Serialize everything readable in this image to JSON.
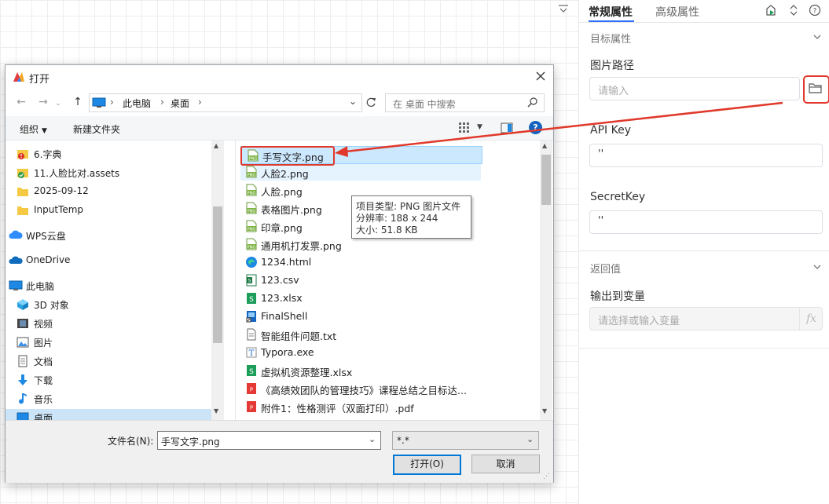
{
  "canvas": {
    "top_right_dropdown": "chevron"
  },
  "panel": {
    "tabs": [
      "常规属性",
      "高级属性"
    ],
    "sections": {
      "target": "目标属性",
      "return": "返回值"
    },
    "fields": {
      "image_path_label": "图片路径",
      "image_path_placeholder": "请输入",
      "api_key_label": "API Key",
      "api_key_value": "''",
      "secret_key_label": "SecretKey",
      "secret_key_value": "''",
      "output_label": "输出到变量",
      "output_placeholder": "请选择或输入变量",
      "fx": "fx"
    }
  },
  "dialog": {
    "title": "打开",
    "breadcrumb": [
      "此电脑",
      "桌面"
    ],
    "search_placeholder": "在 桌面 中搜索",
    "toolbar": {
      "organize": "组织",
      "new_folder": "新建文件夹",
      "help": "?"
    },
    "nav_items": [
      {
        "label": "6.字典",
        "icon": "red-badge-folder-icon"
      },
      {
        "label": "11.人脸比对.assets",
        "icon": "green-check-folder-icon"
      },
      {
        "label": "2025-09-12",
        "icon": "folder-icon"
      },
      {
        "label": "InputTemp",
        "icon": "folder-icon"
      },
      {
        "label": "WPS云盘",
        "icon": "wps-cloud-icon"
      },
      {
        "label": "OneDrive",
        "icon": "onedrive-icon"
      },
      {
        "label": "此电脑",
        "icon": "computer-icon"
      },
      {
        "label": "3D 对象",
        "icon": "3d-objects-icon"
      },
      {
        "label": "视频",
        "icon": "video-icon"
      },
      {
        "label": "图片",
        "icon": "pictures-icon"
      },
      {
        "label": "文档",
        "icon": "documents-icon"
      },
      {
        "label": "下载",
        "icon": "download-icon"
      },
      {
        "label": "音乐",
        "icon": "music-icon"
      },
      {
        "label": "桌面",
        "icon": "desktop-icon"
      }
    ],
    "files": [
      {
        "name": "手写文字.png",
        "icon": "png"
      },
      {
        "name": "人脸2.png",
        "icon": "png"
      },
      {
        "name": "人脸.png",
        "icon": "png"
      },
      {
        "name": "表格图片.png",
        "icon": "png"
      },
      {
        "name": "印章.png",
        "icon": "png"
      },
      {
        "name": "通用机打发票.png",
        "icon": "png"
      },
      {
        "name": "1234.html",
        "icon": "edge"
      },
      {
        "name": "123.csv",
        "icon": "csv"
      },
      {
        "name": "123.xlsx",
        "icon": "xlsx"
      },
      {
        "name": "FinalShell",
        "icon": "shortcut"
      },
      {
        "name": "智能组件问题.txt",
        "icon": "txt"
      },
      {
        "name": "Typora.exe",
        "icon": "exe"
      },
      {
        "name": "虚拟机资源整理.xlsx",
        "icon": "xlsx"
      },
      {
        "name": "《高绩效团队的管理技巧》课程总结之目标达...",
        "icon": "pdf"
      },
      {
        "name": "附件1：性格测评（双面打印）.pdf",
        "icon": "pdf"
      }
    ],
    "tooltip": {
      "type": "项目类型: PNG 图片文件",
      "resolution": "分辨率: 188 x 244",
      "size": "大小: 51.8 KB"
    },
    "filename_label": "文件名(N):",
    "filename_value": "手写文字.png",
    "filter_value": "*.*",
    "open_button": "打开(O)",
    "cancel_button": "取消"
  },
  "annotation_color": "#e0392b"
}
